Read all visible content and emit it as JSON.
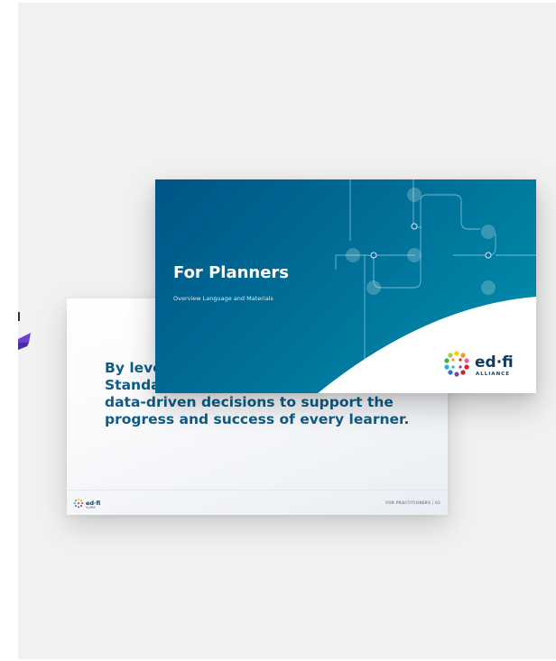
{
  "front_slide": {
    "title": "For Planners",
    "subtitle": "Overview Language and Materials",
    "logo": {
      "wordmark": "ed·fi",
      "tagline": "ALLIANCE"
    }
  },
  "back_slide": {
    "lines": [
      "By leve",
      "Standa",
      "data-driven decisions to support the",
      "progress and success of every learner."
    ],
    "footer_text": "FOR PRACTITIONERS | 02",
    "logo": {
      "wordmark": "ed·fi",
      "tagline": "ALLIANCE"
    }
  },
  "colors": {
    "background": "#f1f1f1",
    "slide_blue_dark": "#005486",
    "slide_blue_light": "#0191ad",
    "accent_teal": "#0f5d86"
  }
}
